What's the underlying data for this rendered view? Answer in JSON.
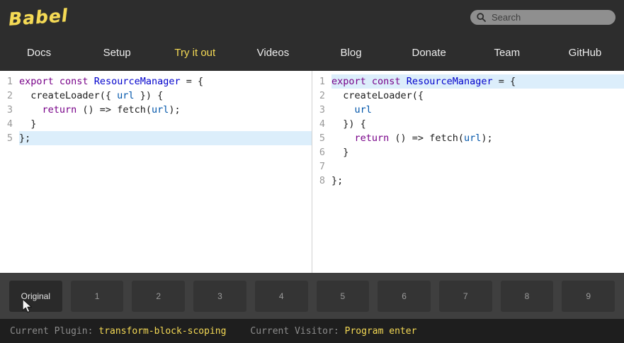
{
  "header": {
    "logo_text": "Babel",
    "search_placeholder": "Search"
  },
  "nav": {
    "items": [
      {
        "label": "Docs",
        "active": false
      },
      {
        "label": "Setup",
        "active": false
      },
      {
        "label": "Try it out",
        "active": true
      },
      {
        "label": "Videos",
        "active": false
      },
      {
        "label": "Blog",
        "active": false
      },
      {
        "label": "Donate",
        "active": false
      },
      {
        "label": "Team",
        "active": false
      },
      {
        "label": "GitHub",
        "active": false
      }
    ]
  },
  "editors": {
    "left": {
      "active_line": 5,
      "lines": [
        [
          {
            "t": "export",
            "c": "k"
          },
          {
            "t": " ",
            "c": "p"
          },
          {
            "t": "const",
            "c": "k"
          },
          {
            "t": " ",
            "c": "p"
          },
          {
            "t": "ResourceManager",
            "c": "d"
          },
          {
            "t": " = {",
            "c": "p"
          }
        ],
        [
          {
            "t": "  createLoader({ ",
            "c": "p"
          },
          {
            "t": "url",
            "c": "v2"
          },
          {
            "t": " }) {",
            "c": "p"
          }
        ],
        [
          {
            "t": "    ",
            "c": "p"
          },
          {
            "t": "return",
            "c": "k"
          },
          {
            "t": " () => fetch(",
            "c": "p"
          },
          {
            "t": "url",
            "c": "v2"
          },
          {
            "t": ");",
            "c": "p"
          }
        ],
        [
          {
            "t": "  }",
            "c": "p"
          }
        ],
        [
          {
            "t": "};",
            "c": "p"
          }
        ]
      ]
    },
    "right": {
      "active_line": 1,
      "lines": [
        [
          {
            "t": "export",
            "c": "k"
          },
          {
            "t": " ",
            "c": "p"
          },
          {
            "t": "const",
            "c": "k"
          },
          {
            "t": " ",
            "c": "p"
          },
          {
            "t": "ResourceManager",
            "c": "d"
          },
          {
            "t": " = {",
            "c": "p"
          }
        ],
        [
          {
            "t": "  createLoader({",
            "c": "p"
          }
        ],
        [
          {
            "t": "    ",
            "c": "p"
          },
          {
            "t": "url",
            "c": "v2"
          }
        ],
        [
          {
            "t": "  }) {",
            "c": "p"
          }
        ],
        [
          {
            "t": "    ",
            "c": "p"
          },
          {
            "t": "return",
            "c": "k"
          },
          {
            "t": " () => fetch(",
            "c": "p"
          },
          {
            "t": "url",
            "c": "v2"
          },
          {
            "t": ");",
            "c": "p"
          }
        ],
        [
          {
            "t": "  }",
            "c": "p"
          }
        ],
        [
          {
            "t": "",
            "c": "p"
          }
        ],
        [
          {
            "t": "};",
            "c": "p"
          }
        ]
      ]
    }
  },
  "timeline": {
    "buttons": [
      {
        "label": "Original",
        "active": true
      },
      {
        "label": "1",
        "active": false
      },
      {
        "label": "2",
        "active": false
      },
      {
        "label": "3",
        "active": false
      },
      {
        "label": "4",
        "active": false
      },
      {
        "label": "5",
        "active": false
      },
      {
        "label": "6",
        "active": false
      },
      {
        "label": "7",
        "active": false
      },
      {
        "label": "8",
        "active": false
      },
      {
        "label": "9",
        "active": false
      }
    ]
  },
  "statusbar": {
    "plugin_label": "Current Plugin:",
    "plugin_value": "transform-block-scoping",
    "visitor_label": "Current Visitor:",
    "visitor_value": "Program enter"
  },
  "colors": {
    "accent": "#f5da55",
    "active_line_bg": "#dceefb",
    "keyword": "#770088",
    "definition": "#0000cc",
    "variable": "#0055aa"
  }
}
